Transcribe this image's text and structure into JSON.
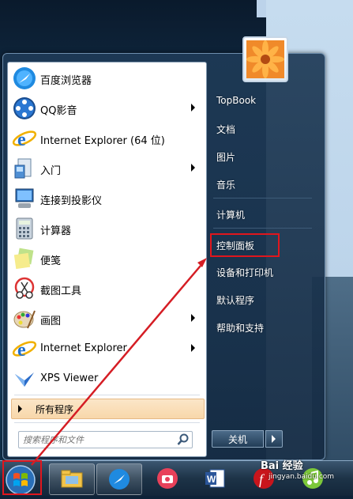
{
  "programs": [
    {
      "label": "百度浏览器",
      "icon": "baidu-browser-icon",
      "has_arrow": false
    },
    {
      "label": "QQ影音",
      "icon": "qq-player-icon",
      "has_arrow": true
    },
    {
      "label": "Internet Explorer (64 位)",
      "icon": "internet-explorer-icon",
      "has_arrow": false
    },
    {
      "label": "入门",
      "icon": "getting-started-icon",
      "has_arrow": true
    },
    {
      "label": "连接到投影仪",
      "icon": "projector-icon",
      "has_arrow": false
    },
    {
      "label": "计算器",
      "icon": "calculator-icon",
      "has_arrow": false
    },
    {
      "label": "便笺",
      "icon": "sticky-notes-icon",
      "has_arrow": false
    },
    {
      "label": "截图工具",
      "icon": "snipping-tool-icon",
      "has_arrow": false
    },
    {
      "label": "画图",
      "icon": "paint-icon",
      "has_arrow": true
    },
    {
      "label": "Internet Explorer",
      "icon": "internet-explorer-icon",
      "has_arrow": true
    },
    {
      "label": "XPS Viewer",
      "icon": "xps-viewer-icon",
      "has_arrow": false
    }
  ],
  "all_programs_label": "所有程序",
  "search_placeholder": "搜索程序和文件",
  "right_items": [
    {
      "label": "TopBook"
    },
    {
      "label": "文档"
    },
    {
      "label": "图片"
    },
    {
      "label": "音乐"
    },
    {
      "label": "计算机"
    },
    {
      "label": "控制面板"
    },
    {
      "label": "设备和打印机"
    },
    {
      "label": "默认程序"
    },
    {
      "label": "帮助和支持"
    }
  ],
  "shutdown_label": "关机",
  "taskbar_apps": [
    "file-explorer-icon",
    "baidu-browser-icon",
    "camera-icon",
    "word-icon",
    "flash-icon",
    "qq-music-icon"
  ],
  "watermark": "Bai 经验",
  "watermark_sub": "jingyan.baidu.com",
  "colors": {
    "highlight": "#e0161d",
    "accent": "#f8d7aa"
  }
}
